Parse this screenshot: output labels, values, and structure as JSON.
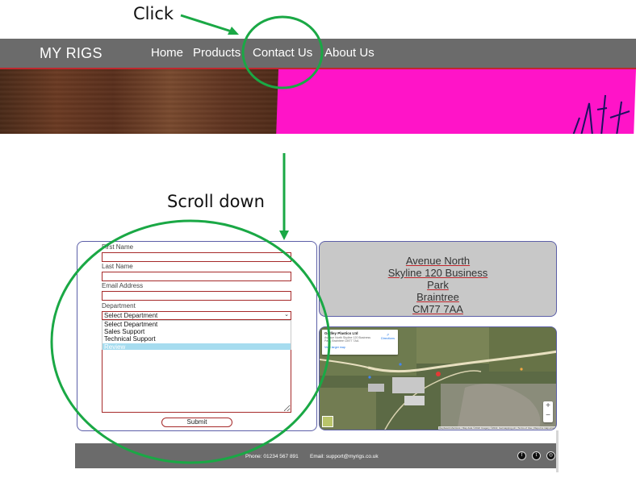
{
  "annotations": {
    "click_label": "Click",
    "scroll_label": "Scroll down",
    "arrow_color": "#1aa845",
    "circle_color": "#1aa845"
  },
  "navbar": {
    "brand": "MY RIGS",
    "links": [
      "Home",
      "Products",
      "Contact Us",
      "About Us"
    ],
    "background": "#6b6b6b",
    "accent": "#c0272d"
  },
  "hero": {
    "colors": {
      "left": "#5a2f1c",
      "right": "#ff14c8"
    }
  },
  "contact_form": {
    "first_name_label": "First Name",
    "last_name_label": "Last Name",
    "email_label": "Email Address",
    "department_label": "Department",
    "department_selected": "Select Department",
    "department_options": [
      "Select Department",
      "Sales Support",
      "Technical Support",
      "Review"
    ],
    "highlighted_option": "Review",
    "submit_label": "Submit"
  },
  "address": {
    "lines": [
      "Avenue North",
      "Skyline 120 Business",
      "Park",
      "Braintree",
      "CM77 7AA"
    ]
  },
  "map": {
    "place_name": "Gedley Plastics Ltd",
    "place_address": "Avenue North Skyline 120 Business Park, Braintree CM77 7AA",
    "larger_map_label": "View larger map",
    "directions_label": "Directions",
    "zoom_in": "+",
    "zoom_out": "−",
    "attribution": "Keyboard shortcuts | Map data ©2022 Imagery ©2022, Getmapping plc | Terms of Use | Report a map error"
  },
  "footer": {
    "phone": "Phone: 01234 567 891",
    "email": "Email: support@myrigs.co.uk",
    "social": [
      "facebook-icon",
      "twitter-icon",
      "instagram-icon"
    ]
  }
}
